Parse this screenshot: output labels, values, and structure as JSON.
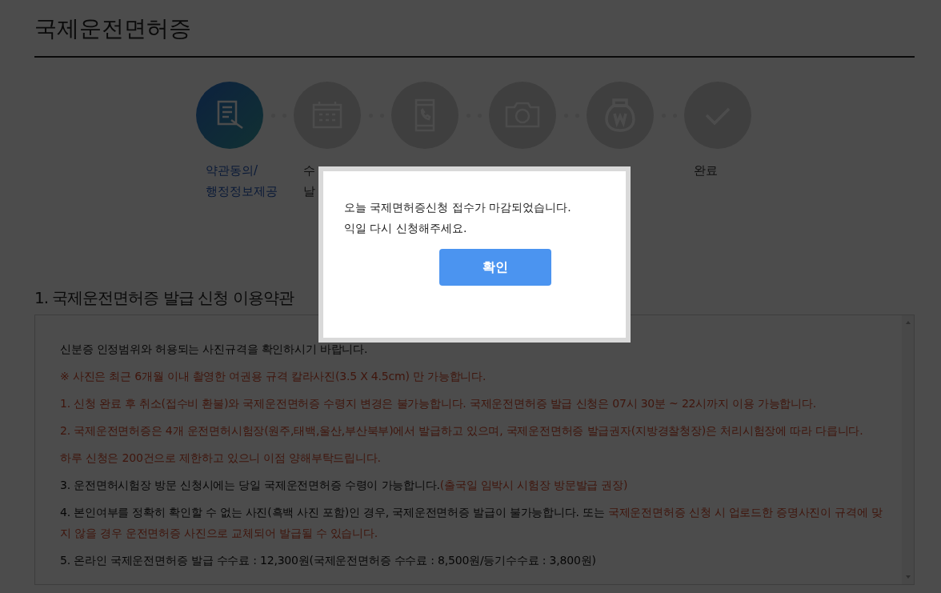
{
  "page_title": "국제운전면허증",
  "steps": [
    {
      "kind": "document",
      "active": true,
      "label": [
        "약관동의/",
        "행정정보제공"
      ]
    },
    {
      "kind": "calendar",
      "active": false,
      "label": [
        "수",
        "날"
      ]
    },
    {
      "kind": "phone",
      "active": false
    },
    {
      "kind": "camera",
      "active": false
    },
    {
      "kind": "moneybag",
      "active": false
    },
    {
      "kind": "check",
      "active": false,
      "label": [
        "완료"
      ]
    }
  ],
  "section_title": "1. 국제운전면허증 발급 신청 이용약관",
  "terms": [
    [
      {
        "text": "신분증 인정범위와 허용되는 사진규격을 확인하시기 바랍니다.",
        "highlighted": false
      }
    ],
    [
      {
        "text": "※ 사진은 최근 6개월 이내 촬영한 여권용 규격 칼라사진(3.5 X 4.5cm) 만 가능합니다.",
        "highlighted": true
      }
    ],
    [
      {
        "text": "1. 신청 완료 후 취소(접수비 환불)와 국제운전면허증 수령지 변경은 불가능합니다. 국제운전면허증 발급 신청은 07시 30분 ~ 22시까지 이용 가능합니다.",
        "highlighted": true
      }
    ],
    [
      {
        "text": "2. 국제운전면허증은 4개 운전면허시험장(원주,태백,울산,부산북부)에서 발급하고 있으며, 국제운전면허증 발급권자(지방경찰청장)은 처리시험장에 따라 다릅니다.",
        "highlighted": true
      }
    ],
    [
      {
        "text": "하루 신청은 200건으로 제한하고 있으니 이점 양해부탁드립니다.",
        "highlighted": true
      }
    ],
    [
      {
        "text": "3. 운전면허시험장 방문 신청시에는 당일 국제운전면허증 수령이 가능합니다.",
        "highlighted": false
      },
      {
        "text": "(출국일 임박시 시험장 방문발급 권장)",
        "highlighted": true
      }
    ],
    [
      {
        "text": "4. 본인여부를 정확히 확인할 수 없는 사진(흑백 사진 포함)인 경우, 국제운전면허증 발급이 불가능합니다. 또는 ",
        "highlighted": false
      },
      {
        "text": "국제운전면허증 신청 시 업로드한 증명사진이 규격에 맞지 않을 경우 운전면허증 사진으로 교체되어 발급될 수 있습니다.",
        "highlighted": true
      }
    ],
    [
      {
        "text": "5. 온라인 국제운전면허증 발급 수수료 : 12,300원(국제운전면허증 수수료 : 8,500원/등기수수료 : 3,800원)",
        "highlighted": false
      }
    ]
  ],
  "dialog": {
    "message": [
      "오늘 국제면허증신청 접수가 마감되었습니다.",
      "익일 다시 신청해주세요."
    ],
    "button": "확인"
  }
}
